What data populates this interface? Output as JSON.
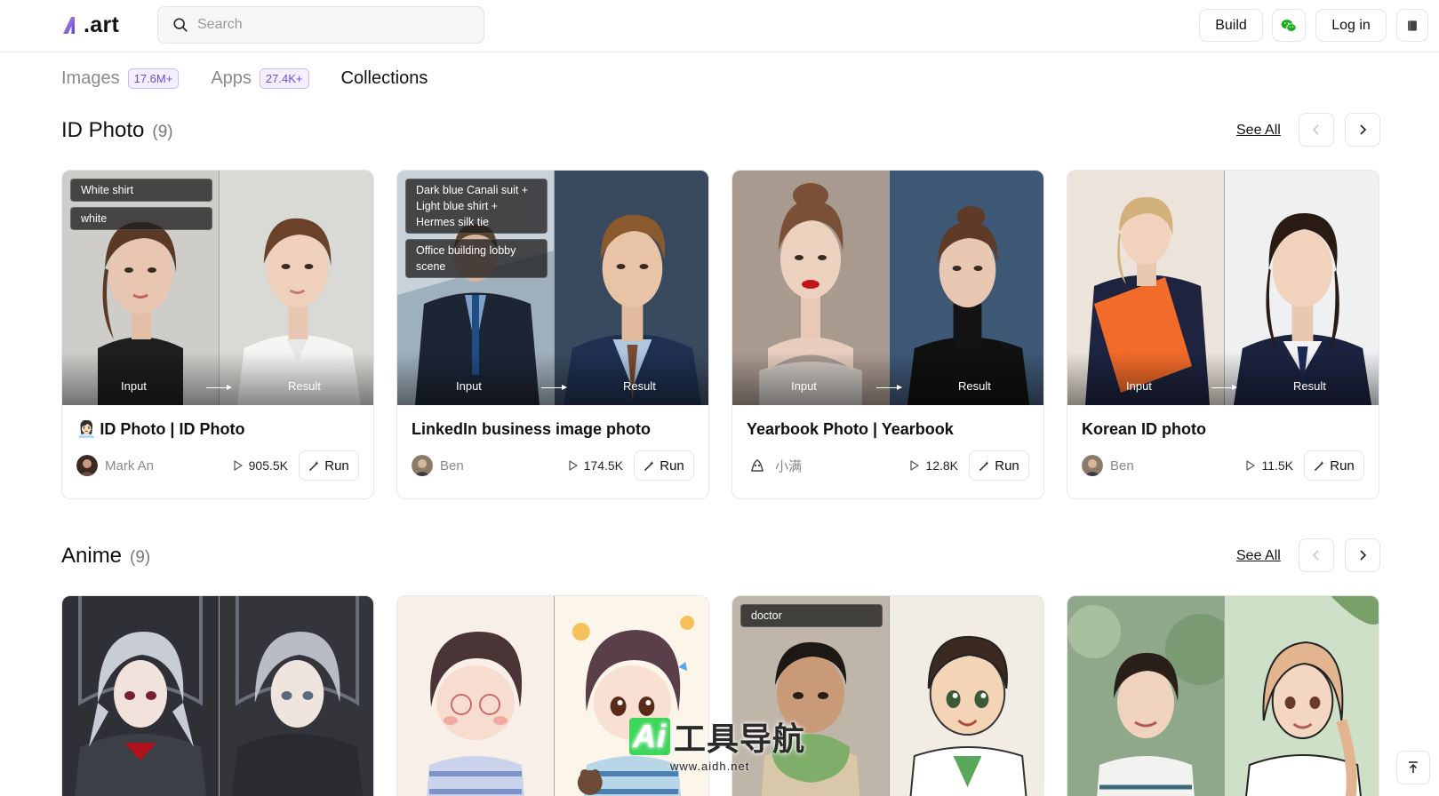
{
  "header": {
    "logo_text": ".art",
    "search_placeholder": "Search",
    "build_label": "Build",
    "login_label": "Log in"
  },
  "tabs": [
    {
      "label": "Images",
      "badge": "17.6M+"
    },
    {
      "label": "Apps",
      "badge": "27.4K+"
    },
    {
      "label": "Collections",
      "badge": ""
    }
  ],
  "sections": [
    {
      "name": "ID Photo",
      "count": "(9)",
      "see_all": "See All",
      "cards": [
        {
          "title": "ID Photo | ID Photo",
          "title_emoji": "👩🏻‍💼",
          "author": "Mark An",
          "plays": "905.5K",
          "run": "Run",
          "tags": [
            "White shirt",
            "white"
          ],
          "input_label": "Input",
          "result_label": "Result"
        },
        {
          "title": "LinkedIn business image photo",
          "author": "Ben",
          "plays": "174.5K",
          "run": "Run",
          "tags": [
            "Dark blue Canali suit + Light blue shirt + Hermes silk tie",
            "Office building lobby scene"
          ],
          "input_label": "Input",
          "result_label": "Result"
        },
        {
          "title": "Yearbook Photo | Yearbook",
          "author": "小满",
          "plays": "12.8K",
          "run": "Run",
          "tags": [],
          "input_label": "Input",
          "result_label": "Result"
        },
        {
          "title": "Korean ID photo",
          "author": "Ben",
          "plays": "11.5K",
          "run": "Run",
          "tags": [],
          "input_label": "Input",
          "result_label": "Result"
        }
      ]
    },
    {
      "name": "Anime",
      "count": "(9)",
      "see_all": "See All",
      "cards": [
        {
          "tags": []
        },
        {
          "tags": []
        },
        {
          "tags": [
            "doctor"
          ]
        },
        {
          "tags": []
        }
      ]
    }
  ],
  "watermark": {
    "ai": "Ai",
    "main": "工具导航",
    "sub": "www.aidh.net"
  },
  "colors": {
    "accent": "#6d4ed8",
    "badge_bg": "#f3efff",
    "wechat_green": "#1aad19"
  }
}
